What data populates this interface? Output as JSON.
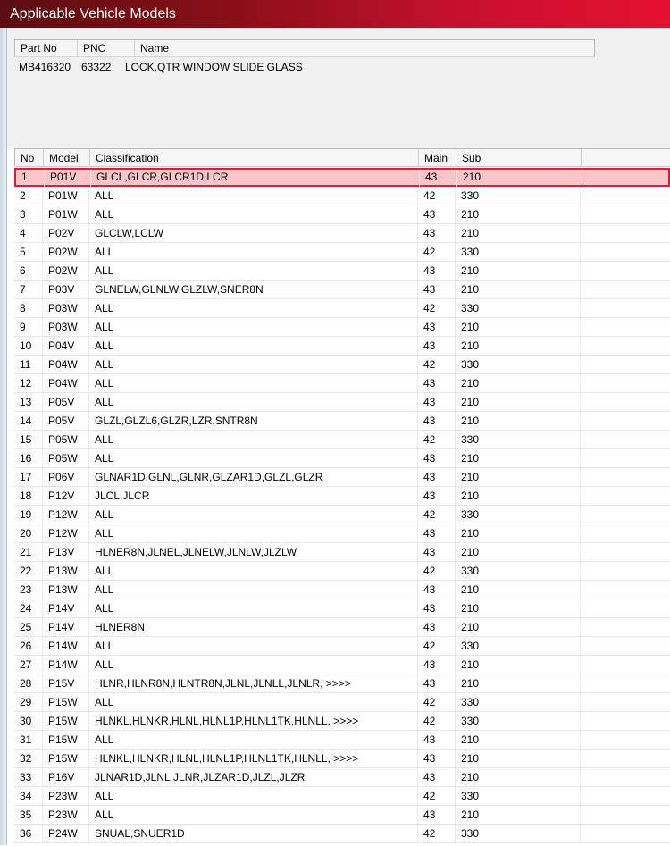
{
  "window": {
    "title": "Applicable Vehicle Models"
  },
  "part_table": {
    "columns": [
      "Part No",
      "PNC",
      "Name"
    ],
    "row": {
      "part_no": "MB416320",
      "pnc": "63322",
      "name": "LOCK,QTR WINDOW SLIDE GLASS"
    }
  },
  "model_table": {
    "columns": [
      "No",
      "Model",
      "Classification",
      "Main",
      "Sub"
    ],
    "selected_index": 0,
    "rows": [
      {
        "no": "1",
        "model": "P01V",
        "classification": "GLCL,GLCR,GLCR1D,LCR",
        "main": "43",
        "sub": "210"
      },
      {
        "no": "2",
        "model": "P01W",
        "classification": "ALL",
        "main": "42",
        "sub": "330"
      },
      {
        "no": "3",
        "model": "P01W",
        "classification": "ALL",
        "main": "43",
        "sub": "210"
      },
      {
        "no": "4",
        "model": "P02V",
        "classification": "GLCLW,LCLW",
        "main": "43",
        "sub": "210"
      },
      {
        "no": "5",
        "model": "P02W",
        "classification": "ALL",
        "main": "42",
        "sub": "330"
      },
      {
        "no": "6",
        "model": "P02W",
        "classification": "ALL",
        "main": "43",
        "sub": "210"
      },
      {
        "no": "7",
        "model": "P03V",
        "classification": "GLNELW,GLNLW,GLZLW,SNER8N",
        "main": "43",
        "sub": "210"
      },
      {
        "no": "8",
        "model": "P03W",
        "classification": "ALL",
        "main": "42",
        "sub": "330"
      },
      {
        "no": "9",
        "model": "P03W",
        "classification": "ALL",
        "main": "43",
        "sub": "210"
      },
      {
        "no": "10",
        "model": "P04V",
        "classification": "ALL",
        "main": "43",
        "sub": "210"
      },
      {
        "no": "11",
        "model": "P04W",
        "classification": "ALL",
        "main": "42",
        "sub": "330"
      },
      {
        "no": "12",
        "model": "P04W",
        "classification": "ALL",
        "main": "43",
        "sub": "210"
      },
      {
        "no": "13",
        "model": "P05V",
        "classification": "ALL",
        "main": "43",
        "sub": "210"
      },
      {
        "no": "14",
        "model": "P05V",
        "classification": "GLZL,GLZL6,GLZR,LZR,SNTR8N",
        "main": "43",
        "sub": "210"
      },
      {
        "no": "15",
        "model": "P05W",
        "classification": "ALL",
        "main": "42",
        "sub": "330"
      },
      {
        "no": "16",
        "model": "P05W",
        "classification": "ALL",
        "main": "43",
        "sub": "210"
      },
      {
        "no": "17",
        "model": "P06V",
        "classification": "GLNAR1D,GLNL,GLNR,GLZAR1D,GLZL,GLZR",
        "main": "43",
        "sub": "210"
      },
      {
        "no": "18",
        "model": "P12V",
        "classification": "JLCL,JLCR",
        "main": "43",
        "sub": "210"
      },
      {
        "no": "19",
        "model": "P12W",
        "classification": "ALL",
        "main": "42",
        "sub": "330"
      },
      {
        "no": "20",
        "model": "P12W",
        "classification": "ALL",
        "main": "43",
        "sub": "210"
      },
      {
        "no": "21",
        "model": "P13V",
        "classification": "HLNER8N,JLNEL,JLNELW,JLNLW,JLZLW",
        "main": "43",
        "sub": "210"
      },
      {
        "no": "22",
        "model": "P13W",
        "classification": "ALL",
        "main": "42",
        "sub": "330"
      },
      {
        "no": "23",
        "model": "P13W",
        "classification": "ALL",
        "main": "43",
        "sub": "210"
      },
      {
        "no": "24",
        "model": "P14V",
        "classification": "ALL",
        "main": "43",
        "sub": "210"
      },
      {
        "no": "25",
        "model": "P14V",
        "classification": "HLNER8N",
        "main": "43",
        "sub": "210"
      },
      {
        "no": "26",
        "model": "P14W",
        "classification": "ALL",
        "main": "42",
        "sub": "330"
      },
      {
        "no": "27",
        "model": "P14W",
        "classification": "ALL",
        "main": "43",
        "sub": "210"
      },
      {
        "no": "28",
        "model": "P15V",
        "classification": "HLNR,HLNR8N,HLNTR8N,JLNL,JLNLL,JLNLR,  >>>>",
        "main": "43",
        "sub": "210"
      },
      {
        "no": "29",
        "model": "P15W",
        "classification": "ALL",
        "main": "42",
        "sub": "330"
      },
      {
        "no": "30",
        "model": "P15W",
        "classification": "HLNKL,HLNKR,HLNL,HLNL1P,HLNL1TK,HLNLL,  >>>>",
        "main": "42",
        "sub": "330"
      },
      {
        "no": "31",
        "model": "P15W",
        "classification": "ALL",
        "main": "43",
        "sub": "210"
      },
      {
        "no": "32",
        "model": "P15W",
        "classification": "HLNKL,HLNKR,HLNL,HLNL1P,HLNL1TK,HLNLL,  >>>>",
        "main": "43",
        "sub": "210"
      },
      {
        "no": "33",
        "model": "P16V",
        "classification": "JLNAR1D,JLNL,JLNR,JLZAR1D,JLZL,JLZR",
        "main": "43",
        "sub": "210"
      },
      {
        "no": "34",
        "model": "P23W",
        "classification": "ALL",
        "main": "42",
        "sub": "330"
      },
      {
        "no": "35",
        "model": "P23W",
        "classification": "ALL",
        "main": "43",
        "sub": "210"
      },
      {
        "no": "36",
        "model": "P24W",
        "classification": "SNUAL,SNUER1D",
        "main": "42",
        "sub": "330"
      }
    ]
  }
}
